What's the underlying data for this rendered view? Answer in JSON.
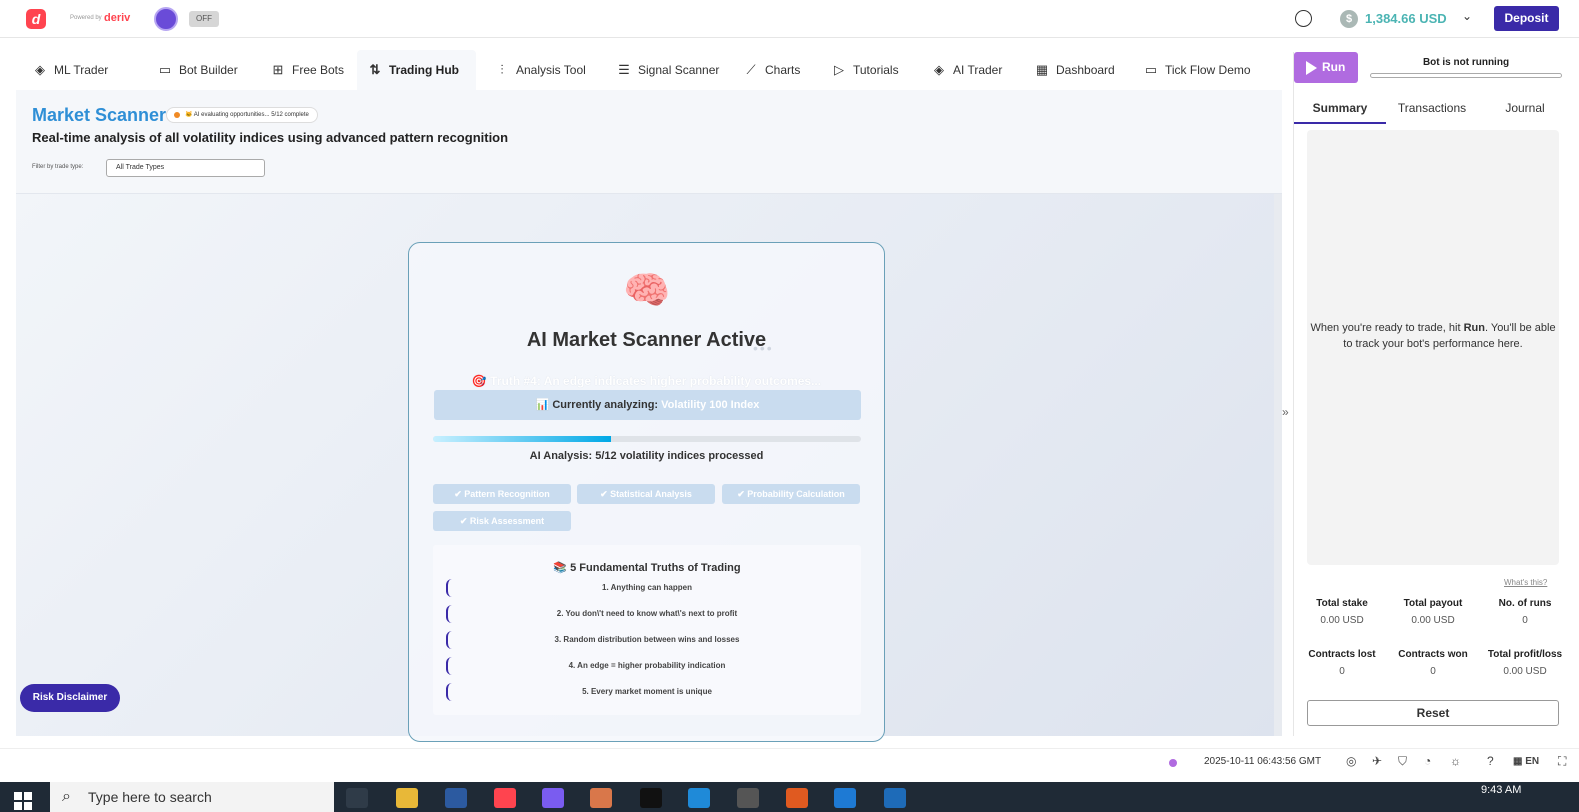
{
  "header": {
    "logo_letter": "d",
    "powered_by": "Powered by",
    "brand": "deriv",
    "toggle_label": "OFF",
    "account_currency_symbol": "$",
    "balance": "1,384.66 USD",
    "deposit_label": "Deposit"
  },
  "nav": {
    "tabs": [
      {
        "label": "ML Trader",
        "icon": "layers-icon"
      },
      {
        "label": "Bot Builder",
        "icon": "monitor-icon"
      },
      {
        "label": "Free Bots",
        "icon": "grid-plus-icon"
      },
      {
        "label": "Trading Hub",
        "icon": "swap-arrows-icon",
        "active": true
      },
      {
        "label": "Analysis Tool",
        "icon": "sliders-icon"
      },
      {
        "label": "Signal Scanner",
        "icon": "list-icon"
      },
      {
        "label": "Charts",
        "icon": "line-chart-icon"
      },
      {
        "label": "Tutorials",
        "icon": "play-icon"
      },
      {
        "label": "AI Trader",
        "icon": "layers-icon"
      },
      {
        "label": "Dashboard",
        "icon": "dashboard-icon"
      },
      {
        "label": "Tick Flow Demo",
        "icon": "monitor-icon"
      }
    ]
  },
  "scanner": {
    "title": "Market Scanner",
    "badge": "🐱 AI evaluating opportunities... 5/12 complete",
    "subtitle": "Real-time analysis of all volatility indices using advanced pattern recognition",
    "filter_label": "Filter by trade type:",
    "filter_value": "All Trade Types"
  },
  "card": {
    "brain": "🧠",
    "title": "AI Market Scanner Active",
    "dots": "•••",
    "truth": "🎯 Truth #4: An edge indicates higher probability outcomes...",
    "analyzing_prefix": "📊 Currently analyzing:",
    "analyzing_market": "Volatility 100 Index",
    "progress_fraction": 0.417,
    "progress_label": "AI Analysis: 5/12 volatility indices processed",
    "chips": [
      "✔ Pattern Recognition",
      "✔ Statistical Analysis",
      "✔ Probability Calculation",
      "✔ Risk Assessment"
    ],
    "truths_title": "📚 5 Fundamental Truths of Trading",
    "truths": [
      "1. Anything can happen",
      "2. You don\\'t need to know what\\'s next to profit",
      "3. Random distribution between wins and losses",
      "4. An edge = higher probability indication",
      "5. Every market moment is unique"
    ]
  },
  "risk_disclaimer": "Risk Disclaimer",
  "panel": {
    "run_label": "Run",
    "bot_status": "Bot is not running",
    "tabs": [
      "Summary",
      "Transactions",
      "Journal"
    ],
    "empty_msg_1": "When you're ready to trade, hit ",
    "empty_msg_run": "Run",
    "empty_msg_2": ". You'll be able to track your bot's performance here.",
    "whats_this": "What's this?",
    "stats": [
      {
        "label": "Total stake",
        "value": "0.00 USD"
      },
      {
        "label": "Total payout",
        "value": "0.00 USD"
      },
      {
        "label": "No. of runs",
        "value": "0"
      },
      {
        "label": "Contracts lost",
        "value": "0"
      },
      {
        "label": "Contracts won",
        "value": "0"
      },
      {
        "label": "Total profit/loss",
        "value": "0.00 USD"
      }
    ],
    "reset_label": "Reset"
  },
  "footer": {
    "timestamp": "2025-10-11 06:43:56 GMT",
    "language": "EN"
  },
  "taskbar": {
    "search_placeholder": "Type here to search",
    "time": "9:43 AM"
  },
  "colors": {
    "brand_red": "#ff444f",
    "primary_purple": "#3a2aa8",
    "run_purple": "#b06be0",
    "balance_teal": "#4bb4b3",
    "scanner_blue": "#2f8fd6"
  }
}
